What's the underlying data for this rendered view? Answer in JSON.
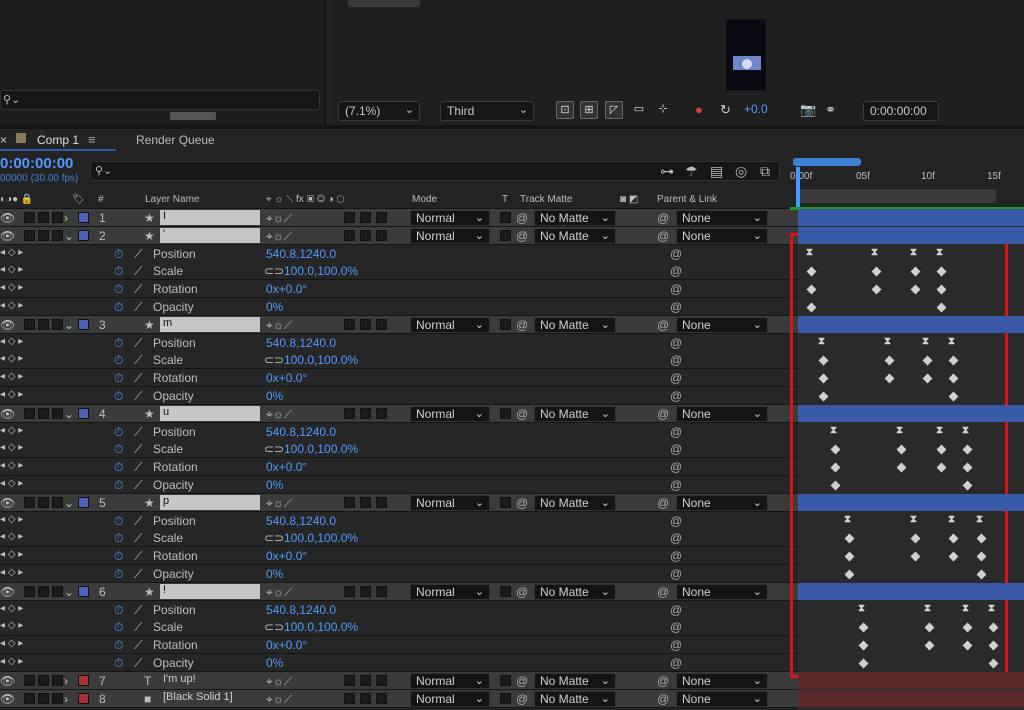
{
  "viewer": {
    "zoom": "(7.1%)",
    "view": "Third",
    "exposure": "+0.0",
    "timecode": "0:00:00:00"
  },
  "tabs": {
    "comp": "Comp 1",
    "render_queue": "Render Queue"
  },
  "timeline": {
    "timecode": "0:00:00:00",
    "fps": "00000 (30.00 fps)",
    "ruler": [
      "0:00f",
      "05f",
      "10f",
      "15f"
    ]
  },
  "header": {
    "num": "#",
    "layer_name": "Layer Name",
    "mode": "Mode",
    "t": "T",
    "track_matte": "Track Matte",
    "parent": "Parent & Link"
  },
  "layers": [
    {
      "num": "1",
      "name": "I",
      "mode": "Normal",
      "matte": "No Matte",
      "parent": "None",
      "color": "#4a63b8"
    },
    {
      "num": "2",
      "name": "'",
      "mode": "Normal",
      "matte": "No Matte",
      "parent": "None",
      "color": "#4a63b8"
    },
    {
      "num": "3",
      "name": "m",
      "mode": "Normal",
      "matte": "No Matte",
      "parent": "None",
      "color": "#4a63b8"
    },
    {
      "num": "4",
      "name": "u",
      "mode": "Normal",
      "matte": "No Matte",
      "parent": "None",
      "color": "#4a63b8"
    },
    {
      "num": "5",
      "name": "p",
      "mode": "Normal",
      "matte": "No Matte",
      "parent": "None",
      "color": "#4a63b8"
    },
    {
      "num": "6",
      "name": "!",
      "mode": "Normal",
      "matte": "No Matte",
      "parent": "None",
      "color": "#4a63b8"
    },
    {
      "num": "7",
      "name": "I'm up!",
      "mode": "Normal",
      "matte": "No Matte",
      "parent": "None",
      "color": "#a83232"
    },
    {
      "num": "8",
      "name": "[Black Solid 1]",
      "mode": "Normal",
      "matte": "No Matte",
      "parent": "None",
      "color": "#a83232"
    }
  ],
  "props": {
    "position": "Position",
    "scale": "Scale",
    "rotation": "Rotation",
    "opacity": "Opacity"
  },
  "values": {
    "position": "540.8,1240.0",
    "scale": "100.0,100.0%",
    "rotation": "0x+0.0°",
    "opacity": "0%"
  }
}
